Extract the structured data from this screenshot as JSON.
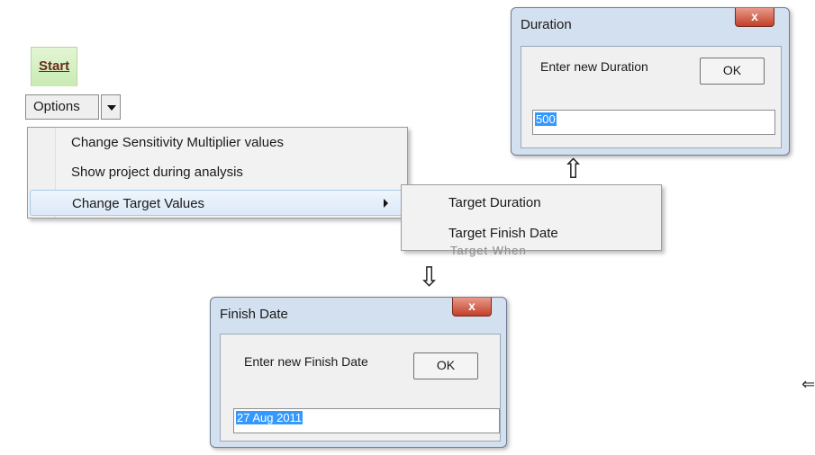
{
  "ribbon": {
    "start_tab": "Start"
  },
  "options_button": {
    "label": "Options"
  },
  "menu": {
    "items": [
      {
        "label": "Change Sensitivity Multiplier values"
      },
      {
        "label": "Show project during analysis"
      },
      {
        "label": "Change Target Values"
      }
    ]
  },
  "submenu": {
    "items": [
      {
        "label": "Target Duration"
      },
      {
        "label": "Target Finish Date"
      }
    ],
    "ghost_text": "Target When"
  },
  "duration_dialog": {
    "title": "Duration",
    "close_label": "x",
    "prompt": "Enter new Duration",
    "ok_label": "OK",
    "value": "500"
  },
  "finish_dialog": {
    "title": "Finish Date",
    "close_label": "x",
    "prompt": "Enter new Finish Date",
    "ok_label": "OK",
    "value": "27 Aug 2011"
  },
  "icons": [
    "up-arrow-icon",
    "down-arrow-icon",
    "chevron-down-icon",
    "submenu-arrow-icon",
    "close-icon"
  ],
  "colors": {
    "tab_green": "#c9ebb3",
    "selection_blue": "#3399ff",
    "close_red": "#c2402a",
    "dialog_frame": "#d3e0ef"
  }
}
